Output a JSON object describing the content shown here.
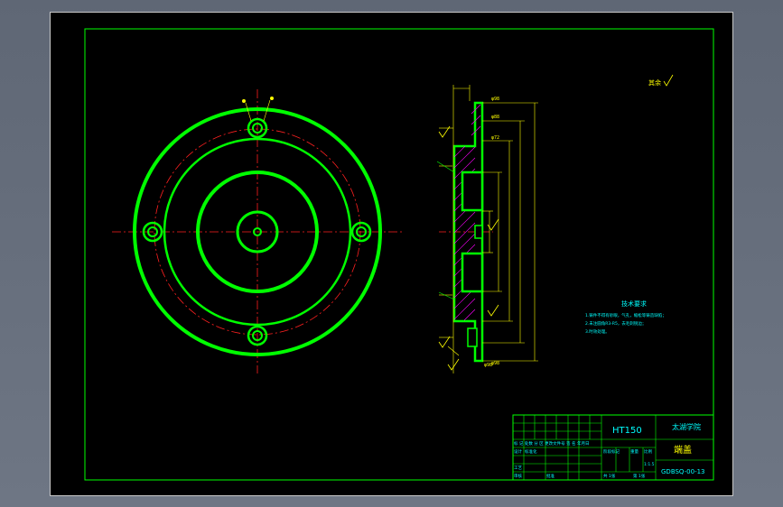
{
  "title_block": {
    "material": "HT150",
    "school": "太湖学院",
    "part_name": "端盖",
    "drawing_number": "GDBSQ-00-13",
    "row_labels_1": "标 记 处数 分 区 更改文件号 签 名 年月日",
    "row_labels_2": "设计",
    "row_labels_3": "标准化",
    "row_labels_4": "审核",
    "row_labels_5": "工艺",
    "row_labels_6": "批准",
    "stage_label": "阶段标记",
    "weight_label": "重量",
    "scale_label": "比例",
    "scale_value": "1:1.5",
    "sheet_total": "共 1张",
    "sheet_no": "第 1张"
  },
  "notes": {
    "heading": "技术要求",
    "lines": [
      "1.铸件不得有砂眼，气孔，缩松等铸造缺陷；",
      "2.未注圆角R3-R5，去毛刺锐边；",
      "3.时效处理。"
    ]
  },
  "surface_finish": "其余",
  "colors": {
    "outline": "#00ff00",
    "center_line": "#ff2020",
    "dimension": "#ffff00",
    "hatch": "#ff00ff",
    "annotation": "#00ffff",
    "frame": "#00ff00"
  }
}
